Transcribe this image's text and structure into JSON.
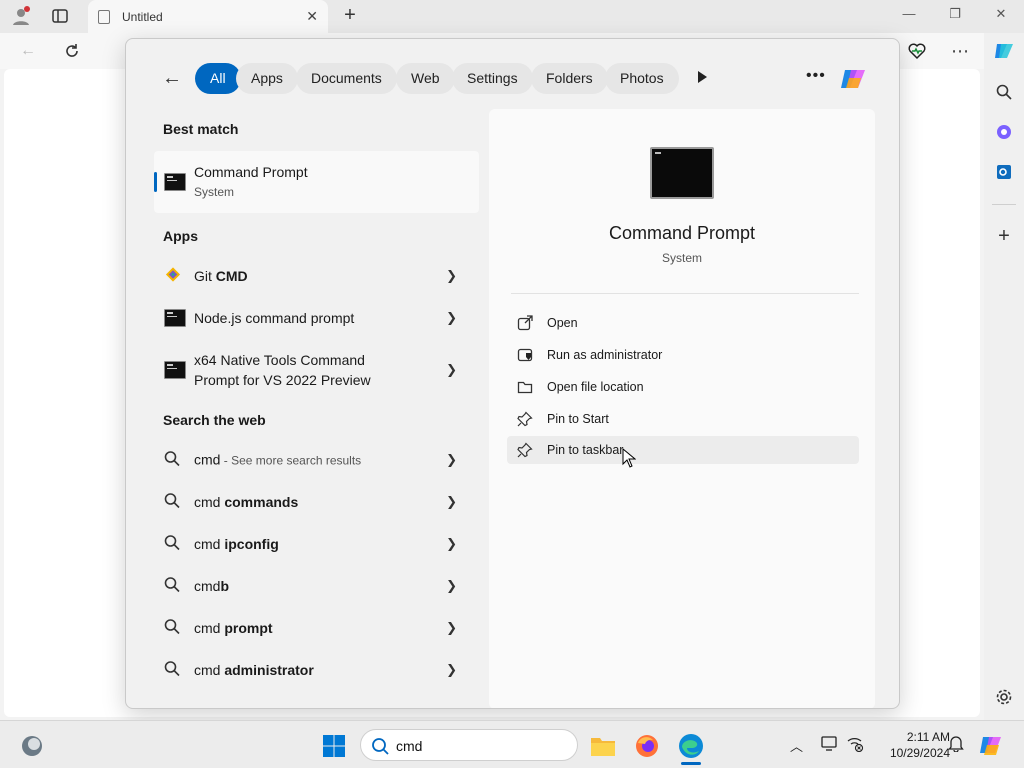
{
  "browser": {
    "tab_title": "Untitled",
    "new_tab": "+",
    "window_controls": {
      "minimize": "—",
      "restore": "❐",
      "close": "✕"
    }
  },
  "search_panel": {
    "filters": [
      {
        "label": "All",
        "active": true
      },
      {
        "label": "Apps"
      },
      {
        "label": "Documents"
      },
      {
        "label": "Web"
      },
      {
        "label": "Settings"
      },
      {
        "label": "Folders"
      },
      {
        "label": "Photos"
      }
    ],
    "sections": {
      "best_match": "Best match",
      "apps": "Apps",
      "search_web": "Search the web"
    },
    "best_match": {
      "title": "Command Prompt",
      "subtitle": "System"
    },
    "apps": [
      {
        "label_plain": "Git ",
        "label_bold": "CMD"
      },
      {
        "label": "Node.js command prompt"
      },
      {
        "label_line1": "x64 Native Tools Command",
        "label_line2": "Prompt for VS 2022 Preview"
      }
    ],
    "web_results": [
      {
        "plain": "cmd",
        "bold": "",
        "hint": " - See more search results"
      },
      {
        "plain": "cmd ",
        "bold": "commands"
      },
      {
        "plain": "cmd ",
        "bold": "ipconfig"
      },
      {
        "plain": "cmd",
        "bold": "b"
      },
      {
        "plain": "cmd ",
        "bold": "prompt"
      },
      {
        "plain": "cmd ",
        "bold": "administrator"
      }
    ],
    "detail": {
      "title": "Command Prompt",
      "subtitle": "System",
      "actions": [
        {
          "label": "Open",
          "icon": "open-external-icon"
        },
        {
          "label": "Run as administrator",
          "icon": "shield-icon"
        },
        {
          "label": "Open file location",
          "icon": "folder-icon"
        },
        {
          "label": "Pin to Start",
          "icon": "pin-icon"
        },
        {
          "label": "Pin to taskbar",
          "icon": "pin-icon",
          "hovered": true
        }
      ]
    }
  },
  "taskbar": {
    "search_value": "cmd",
    "time": "2:11 AM",
    "date": "10/29/2024"
  },
  "colors": {
    "accent": "#0067c0",
    "panel_bg": "#f1f1f1",
    "taskbar_bg": "#ececec"
  }
}
